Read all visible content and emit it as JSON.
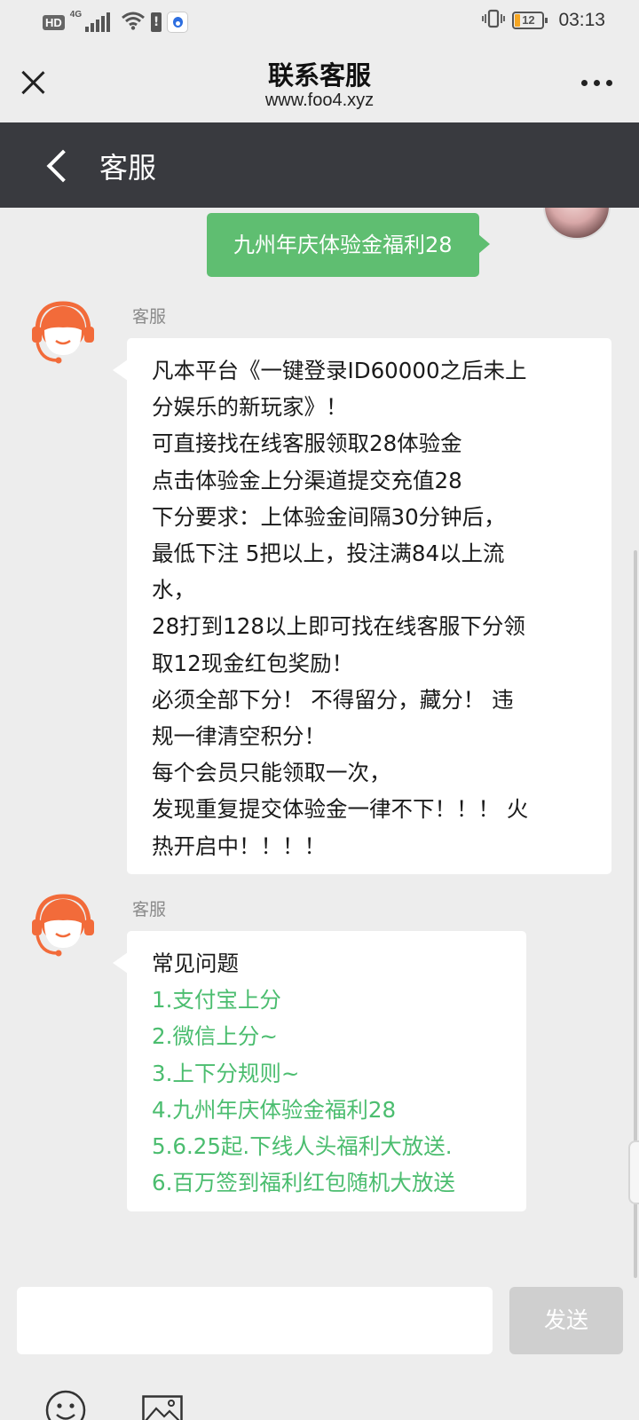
{
  "status_bar": {
    "hd_label": "HD",
    "network_label": "4G",
    "alert_glyph": "!",
    "app_icon": "baidu-paw-icon",
    "vibrate_glyph": "▯",
    "battery_level": "12",
    "time": "03:13"
  },
  "top_bar": {
    "title": "联系客服",
    "url": "www.foo4.xyz"
  },
  "nav_bar": {
    "title": "客服"
  },
  "chat": {
    "user_message": "九州年庆体验金福利28",
    "messages": [
      {
        "sender": "客服",
        "lines": [
          "凡本平台《一键登录ID60000之后未上",
          "分娱乐的新玩家》！",
          "可直接找在线客服领取28体验金",
          "点击体验金上分渠道提交充值28",
          "下分要求：上体验金间隔30分钟后，",
          "最低下注 5把以上，投注满84以上流",
          "水，",
          "28打到128以上即可找在线客服下分领",
          "取12现金红包奖励！",
          "必须全部下分！ 不得留分，藏分！ 违",
          "规一律清空积分！",
          "每个会员只能领取一次，",
          "发现重复提交体验金一律不下！！！ 火",
          "热开启中！！！！"
        ]
      },
      {
        "sender": "客服",
        "title": "常见问题",
        "links": [
          "1.支付宝上分",
          "2.微信上分~",
          "3.上下分规则~",
          "4.九州年庆体验金福利28",
          "5.6.25起.下线人头福利大放送.",
          "6.百万签到福利红包随机大放送"
        ]
      }
    ]
  },
  "input_bar": {
    "placeholder": "",
    "send_label": "发送"
  },
  "colors": {
    "accent_green": "#5fbe71",
    "link_green": "#4bbd6f",
    "nav_dark": "#393a3f",
    "avatar_orange": "#f26b3a"
  }
}
